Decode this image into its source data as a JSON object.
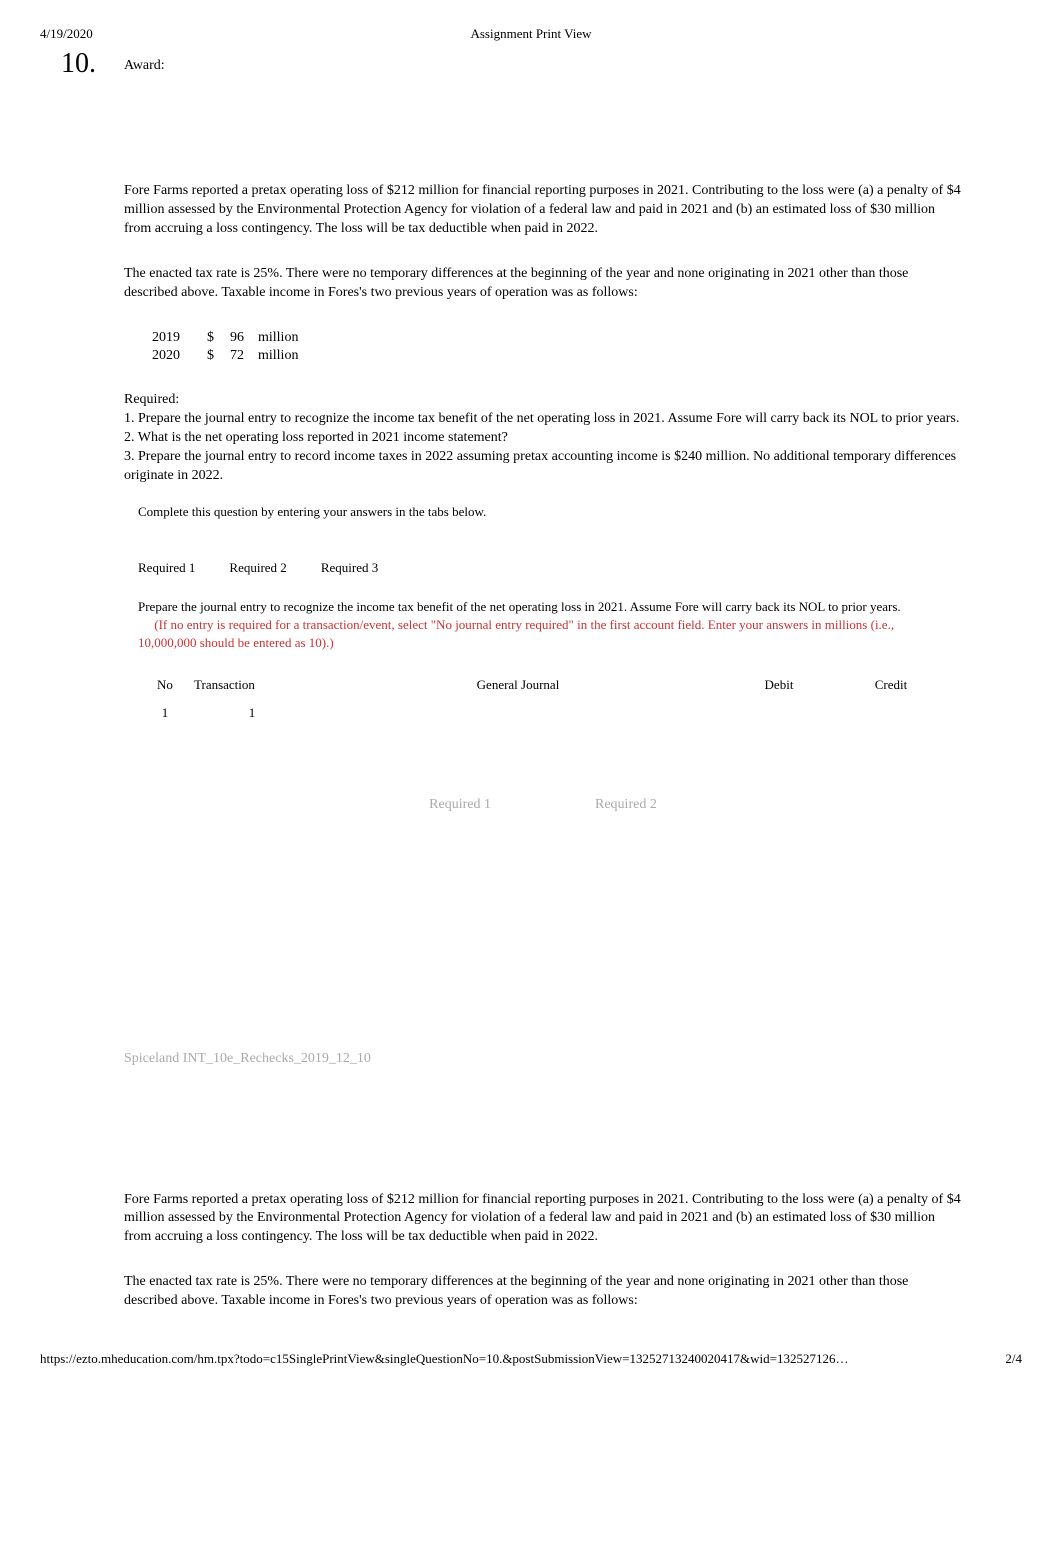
{
  "header": {
    "date": "4/19/2020",
    "title": "Assignment Print View"
  },
  "question": {
    "number": "10.",
    "award_label": "Award:"
  },
  "problem": {
    "para1": "Fore Farms reported a pretax operating loss of $212 million for financial reporting purposes in 2021. Contributing to the loss were (a) a penalty of $4 million assessed by the Environmental Protection Agency for violation of a federal law and paid in 2021 and (b) an estimated loss of $30 million from accruing a loss contingency. The loss will be tax deductible when paid in 2022.",
    "para2": "The enacted tax rate is 25%. There were no temporary differences at the beginning of the year and none originating in 2021 other than those described above. Taxable income in Fores's two previous years of operation was as follows:",
    "income": [
      {
        "year": "2019",
        "symbol": "$",
        "amount": "96",
        "unit": "million"
      },
      {
        "year": "2020",
        "symbol": "$",
        "amount": "72",
        "unit": "million"
      }
    ],
    "required_label": "Required:",
    "requirements": "1. Prepare the journal entry to recognize the income tax benefit of the net operating loss in 2021. Assume Fore will carry back its NOL to prior years.\n2. What is the net operating loss reported in 2021 income statement?\n3. Prepare the journal entry to record income taxes in 2022 assuming pretax accounting income is $240 million. No additional temporary differences originate in 2022."
  },
  "panel": {
    "instruction": "Complete this question by entering your answers in the tabs below.",
    "tabs": {
      "t1": "Required 1",
      "t2": "Required 2",
      "t3": "Required 3"
    },
    "tab_instruction_black1": "Prepare the journal entry to recognize the income tax benefit of the net operating loss in 2021. Assume Fore will carry back its NOL to prior years.",
    "tab_instruction_red": "(If no entry is required for a transaction/event, select \"No journal entry required\" in the first account field. Enter your answers in millions (i.e., 10,000,000 should be entered as 10).)",
    "journal_headers": {
      "no": "No",
      "transaction": "Transaction",
      "gj": "General Journal",
      "debit": "Debit",
      "credit": "Credit"
    },
    "journal_rows": [
      {
        "no": "1",
        "transaction": "1",
        "gj": "",
        "debit": "",
        "credit": ""
      }
    ],
    "nav_prev": "Required 1",
    "nav_next": "Required 2"
  },
  "footer_ref": "Spiceland INT_10e_Rechecks_2019_12_10",
  "page_footer": {
    "url": "https://ezto.mheducation.com/hm.tpx?todo=c15SinglePrintView&singleQuestionNo=10.&postSubmissionView=13252713240020417&wid=132527126…",
    "page": "2/4"
  }
}
